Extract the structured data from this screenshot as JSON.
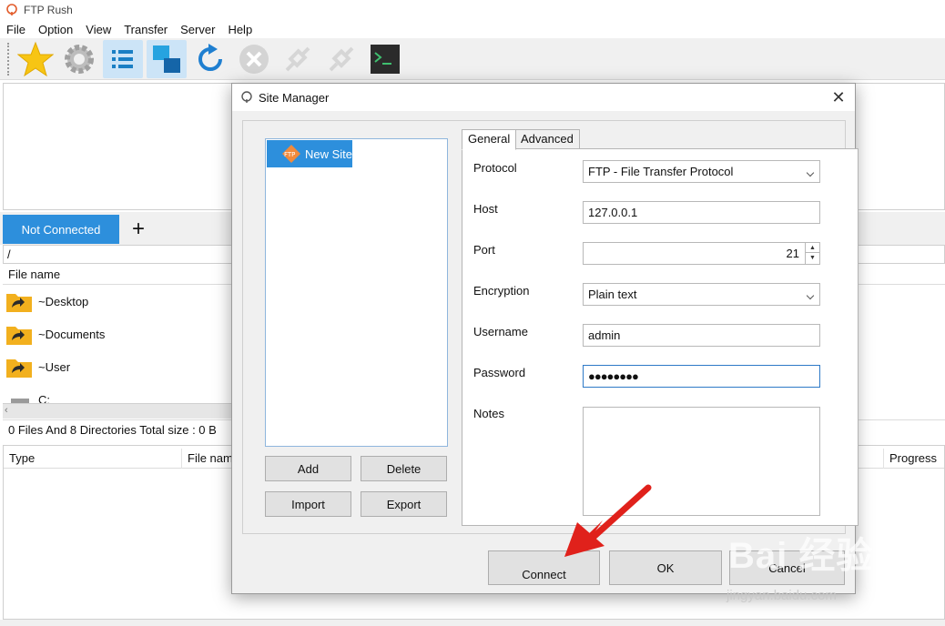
{
  "app": {
    "title": "FTP Rush"
  },
  "menu": [
    "File",
    "Option",
    "View",
    "Transfer",
    "Server",
    "Help"
  ],
  "toolbar": {
    "icons": [
      "star-icon",
      "gear-icon",
      "list-icon",
      "windows-icon",
      "refresh-icon",
      "cancel-icon",
      "disconnect-icon",
      "connect-icon",
      "terminal-icon"
    ],
    "accent": "#2d8fdc"
  },
  "connection_tab": {
    "label": "Not Connected",
    "add_label": "+"
  },
  "path": "/",
  "file_list": {
    "header": "File name",
    "items": [
      "~Desktop",
      "~Documents",
      "~User",
      "C:"
    ],
    "status": "0 Files And 8 Directories Total size : 0 B"
  },
  "queue": {
    "columns": [
      "Type",
      "File nam",
      "Progress"
    ]
  },
  "dialog": {
    "title": "Site Manager",
    "close_label": "✕",
    "site_list": {
      "items": [
        "New Site"
      ]
    },
    "buttons": {
      "add": "Add",
      "delete": "Delete",
      "import": "Import",
      "export": "Export",
      "connect": "Connect",
      "ok": "OK",
      "cancel": "Cancel"
    },
    "tabs": [
      "General",
      "Advanced"
    ],
    "form": {
      "protocol_label": "Protocol",
      "protocol_value": "FTP - File Transfer Protocol",
      "host_label": "Host",
      "host_value": "127.0.0.1",
      "port_label": "Port",
      "port_value": "21",
      "encryption_label": "Encryption",
      "encryption_value": "Plain text",
      "username_label": "Username",
      "username_value": "admin",
      "password_label": "Password",
      "password_value": "●●●●●●●●",
      "notes_label": "Notes",
      "notes_value": ""
    }
  },
  "watermark": {
    "text": "Bai 经验",
    "url": "jingyan.baidu.com"
  }
}
